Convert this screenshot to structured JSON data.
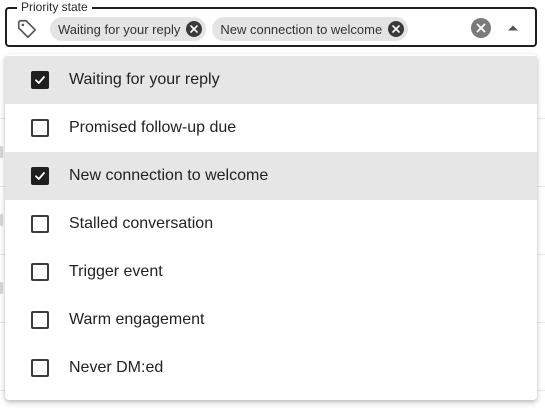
{
  "field": {
    "label": "Priority state",
    "leading_icon": "tag-icon",
    "clear_icon": "clear-icon",
    "toggle_icon": "caret-up-icon"
  },
  "chips": [
    {
      "label": "Waiting for your reply"
    },
    {
      "label": "New connection to welcome"
    }
  ],
  "options": [
    {
      "label": "Waiting for your reply",
      "checked": true
    },
    {
      "label": "Promised follow-up due",
      "checked": false
    },
    {
      "label": "New connection to welcome",
      "checked": true
    },
    {
      "label": "Stalled conversation",
      "checked": false
    },
    {
      "label": "Trigger event",
      "checked": false
    },
    {
      "label": "Warm engagement",
      "checked": false
    },
    {
      "label": "Never DM:ed",
      "checked": false
    }
  ],
  "colors": {
    "border": "#1f1f1f",
    "chip_bg": "#e4e4e4",
    "selected_row_bg": "#e6e6e6",
    "checkbox_checked": "#1f1f1f"
  }
}
